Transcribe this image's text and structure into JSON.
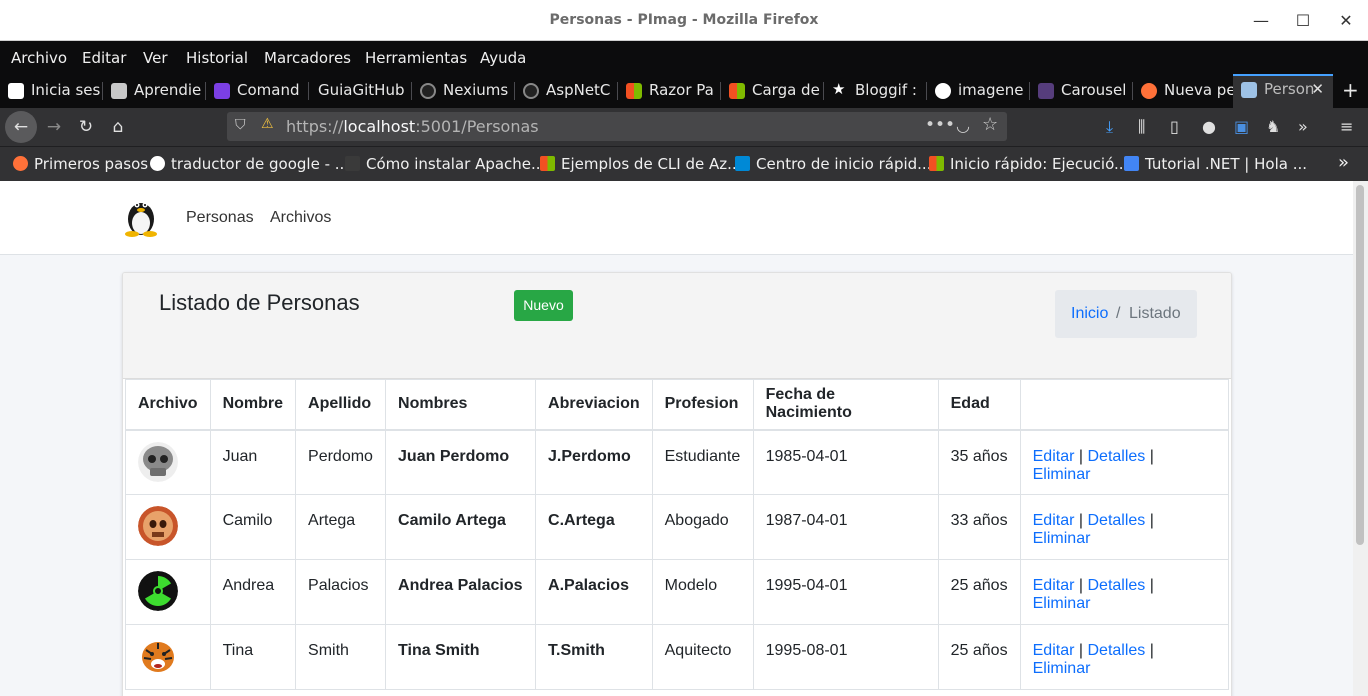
{
  "window": {
    "title": "Personas - PImag - Mozilla Firefox",
    "minimize_glyph": "—",
    "maximize_glyph": "☐",
    "close_glyph": "✕"
  },
  "menu": [
    "Archivo",
    "Editar",
    "Ver",
    "Historial",
    "Marcadores",
    "Herramientas",
    "Ayuda"
  ],
  "tabs": [
    {
      "label": "Inicia ses",
      "icon": "google-icon",
      "color": "#ffffff"
    },
    {
      "label": "Aprendie",
      "icon": "book-icon",
      "color": "#c8c8c8"
    },
    {
      "label": "Comand",
      "icon": "hashnode-icon",
      "color": "#7b3fe4"
    },
    {
      "label": "GuiaGitHub",
      "icon": "",
      "color": ""
    },
    {
      "label": "Nexiums",
      "icon": "github-icon",
      "color": "#222222"
    },
    {
      "label": "AspNetC",
      "icon": "github-icon",
      "color": "#222222"
    },
    {
      "label": "Razor Pa",
      "icon": "microsoft-icon",
      "color": "#f25022"
    },
    {
      "label": "Carga de",
      "icon": "microsoft-icon",
      "color": "#f25022"
    },
    {
      "label": "Bloggif :",
      "icon": "star-icon",
      "color": "#ffffff"
    },
    {
      "label": "imagene",
      "icon": "google-icon",
      "color": "#ffffff"
    },
    {
      "label": "Carousel",
      "icon": "bootstrap-icon",
      "color": "#563d7c"
    },
    {
      "label": "Nueva pe",
      "icon": "firefox-icon",
      "color": "#ff7139"
    },
    {
      "label": "Person",
      "icon": "page-icon",
      "color": "#9ec2e6"
    }
  ],
  "urlbar": {
    "url_prefix": "https://",
    "url_host": "localhost",
    "url_rest": ":5001/Personas"
  },
  "bookmarks": [
    {
      "label": "Primeros pasos",
      "icon": "firefox-icon",
      "color": "#ff7139"
    },
    {
      "label": "traductor de google - ...",
      "icon": "google-icon",
      "color": "#ffffff"
    },
    {
      "label": "Cómo instalar Apache...",
      "icon": "digitalocean-icon",
      "color": "#ff5a00"
    },
    {
      "label": "Ejemplos de CLI de Az...",
      "icon": "microsoft-icon",
      "color": "#f25022"
    },
    {
      "label": "Centro de inicio rápid...",
      "icon": "azure-icon",
      "color": "#0089d6"
    },
    {
      "label": "Inicio rápido: Ejecució...",
      "icon": "microsoft-icon",
      "color": "#f25022"
    },
    {
      "label": "Tutorial .NET | Hola ...",
      "icon": "translate-icon",
      "color": "#4285f4"
    }
  ],
  "site_nav": {
    "link1": "Personas",
    "link2": "Archivos"
  },
  "card": {
    "title": "Listado de Personas",
    "new_button": "Nuevo",
    "breadcrumb_home": "Inicio",
    "breadcrumb_sep": "/",
    "breadcrumb_current": "Listado"
  },
  "table": {
    "headers": [
      "Archivo",
      "Nombre",
      "Apellido",
      "Nombres",
      "Abreviacion",
      "Profesion",
      "Fecha de Nacimiento",
      "Edad",
      ""
    ],
    "actions": {
      "edit": "Editar",
      "details": "Detalles",
      "delete": "Eliminar",
      "sep": "|"
    },
    "rows": [
      {
        "avatar": "skull-avatar",
        "nombre": "Juan",
        "apellido": "Perdomo",
        "nombres": "Juan Perdomo",
        "abreviacion": "J.Perdomo",
        "profesion": "Estudiante",
        "fecha": "1985-04-01",
        "edad": "35 años"
      },
      {
        "avatar": "flaming-skull-avatar",
        "nombre": "Camilo",
        "apellido": "Artega",
        "nombres": "Camilo Artega",
        "abreviacion": "C.Artega",
        "profesion": "Abogado",
        "fecha": "1987-04-01",
        "edad": "33 años"
      },
      {
        "avatar": "radioactive-avatar",
        "nombre": "Andrea",
        "apellido": "Palacios",
        "nombres": "Andrea Palacios",
        "abreviacion": "A.Palacios",
        "profesion": "Modelo",
        "fecha": "1995-04-01",
        "edad": "25 años"
      },
      {
        "avatar": "tiger-avatar",
        "nombre": "Tina",
        "apellido": "Smith",
        "nombres": "Tina Smith",
        "abreviacion": "T.Smith",
        "profesion": "Aquitecto",
        "fecha": "1995-08-01",
        "edad": "25 años"
      }
    ]
  }
}
